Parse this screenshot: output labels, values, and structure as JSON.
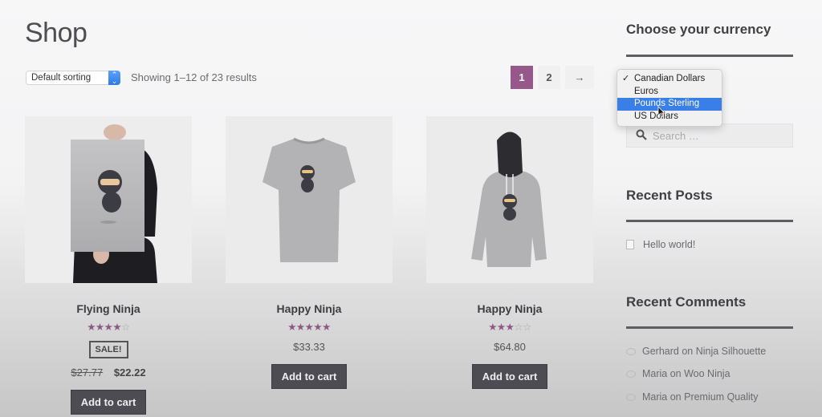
{
  "page": {
    "title": "Shop"
  },
  "toolbar": {
    "sorting": {
      "selected": "Default sorting",
      "icon": "select-stepper-icon"
    },
    "result_count": "Showing 1–12 of 23 results"
  },
  "pagination": {
    "pages": [
      "1",
      "2"
    ],
    "current": "1",
    "next_label": "→"
  },
  "products": [
    {
      "title": "Flying Ninja",
      "image": "poster-held-by-person",
      "rating": 4,
      "max_rating": 5,
      "on_sale": true,
      "sale_label": "SALE!",
      "regular_price": "$27.77",
      "sale_price": "$22.22",
      "button_label": "Add to cart"
    },
    {
      "title": "Happy Ninja",
      "image": "grey-tshirt-ninja",
      "rating": 5,
      "max_rating": 5,
      "on_sale": false,
      "price": "$33.33",
      "button_label": "Add to cart"
    },
    {
      "title": "Happy Ninja",
      "image": "grey-hoodie-ninja",
      "rating": 3,
      "max_rating": 5,
      "on_sale": false,
      "price": "$64.80",
      "button_label": "Add to cart"
    }
  ],
  "sidebar": {
    "currency_widget": {
      "title": "Choose your currency",
      "options": [
        "Canadian Dollars",
        "Euros",
        "Pounds Sterling",
        "US Dollars"
      ],
      "selected": "Canadian Dollars",
      "highlighted": "Pounds Sterling"
    },
    "search": {
      "placeholder": "Search …",
      "icon": "search-icon"
    },
    "recent_posts": {
      "title": "Recent Posts",
      "items": [
        "Hello world!"
      ]
    },
    "recent_comments": {
      "title": "Recent Comments",
      "items": [
        "Gerhard on Ninja Silhouette",
        "Maria on Woo Ninja",
        "Maria on Premium Quality"
      ]
    }
  },
  "colors": {
    "accent": "#96588a",
    "star": "#8a5a84",
    "button": "#4c4c52",
    "menu_highlight": "#3a7ee8"
  }
}
